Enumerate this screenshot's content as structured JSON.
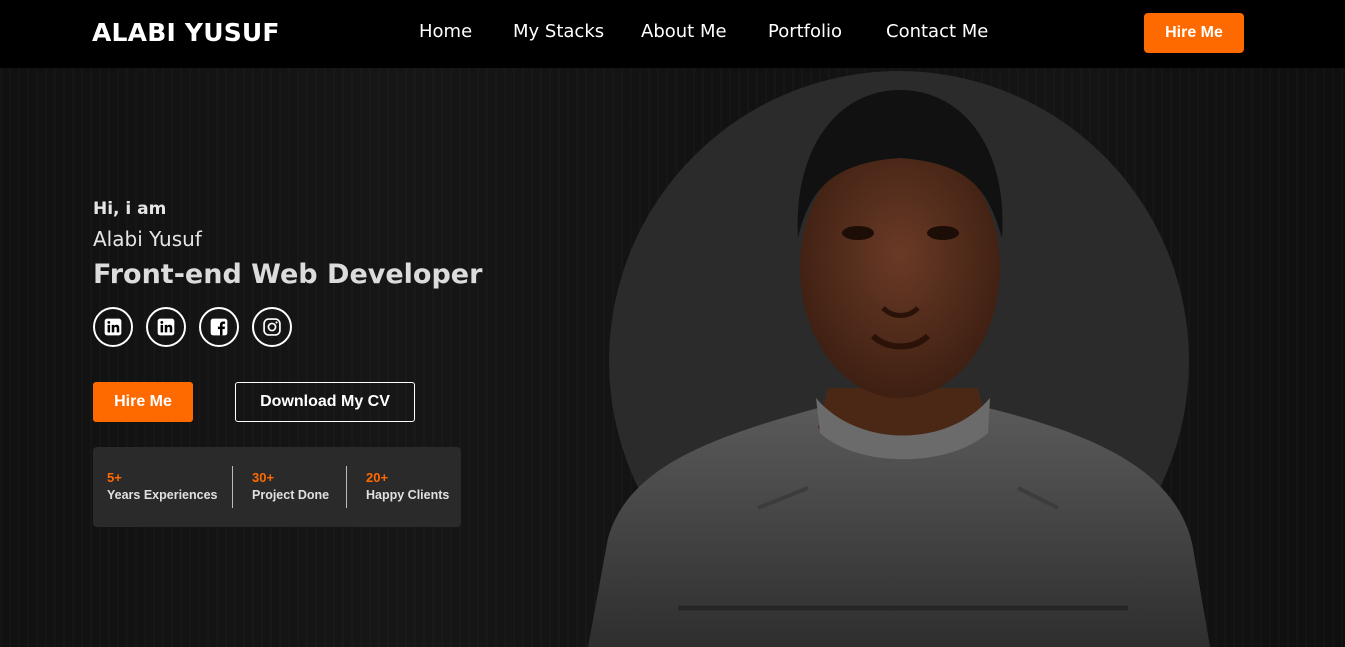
{
  "nav": {
    "logo": "ALABI YUSUF",
    "links": [
      "Home",
      "My Stacks",
      "About Me",
      "Portfolio",
      "Contact Me"
    ],
    "hire_label": "Hire Me"
  },
  "hero": {
    "greeting": "Hi, i am",
    "name": "Alabi Yusuf",
    "role": "Front-end Web Developer",
    "socials": [
      "linkedin-icon",
      "linkedin-icon",
      "facebook-icon",
      "instagram-icon"
    ],
    "hire_label": "Hire Me",
    "cv_label": "Download My CV"
  },
  "stats": [
    {
      "value": "5+",
      "label": "Years Experiences"
    },
    {
      "value": "30+",
      "label": "Project Done"
    },
    {
      "value": "20+",
      "label": "Happy Clients"
    }
  ],
  "colors": {
    "accent": "#ff6a00",
    "navbar": "#000000",
    "background": "#111111",
    "stats_card": "#2a2a2a"
  }
}
